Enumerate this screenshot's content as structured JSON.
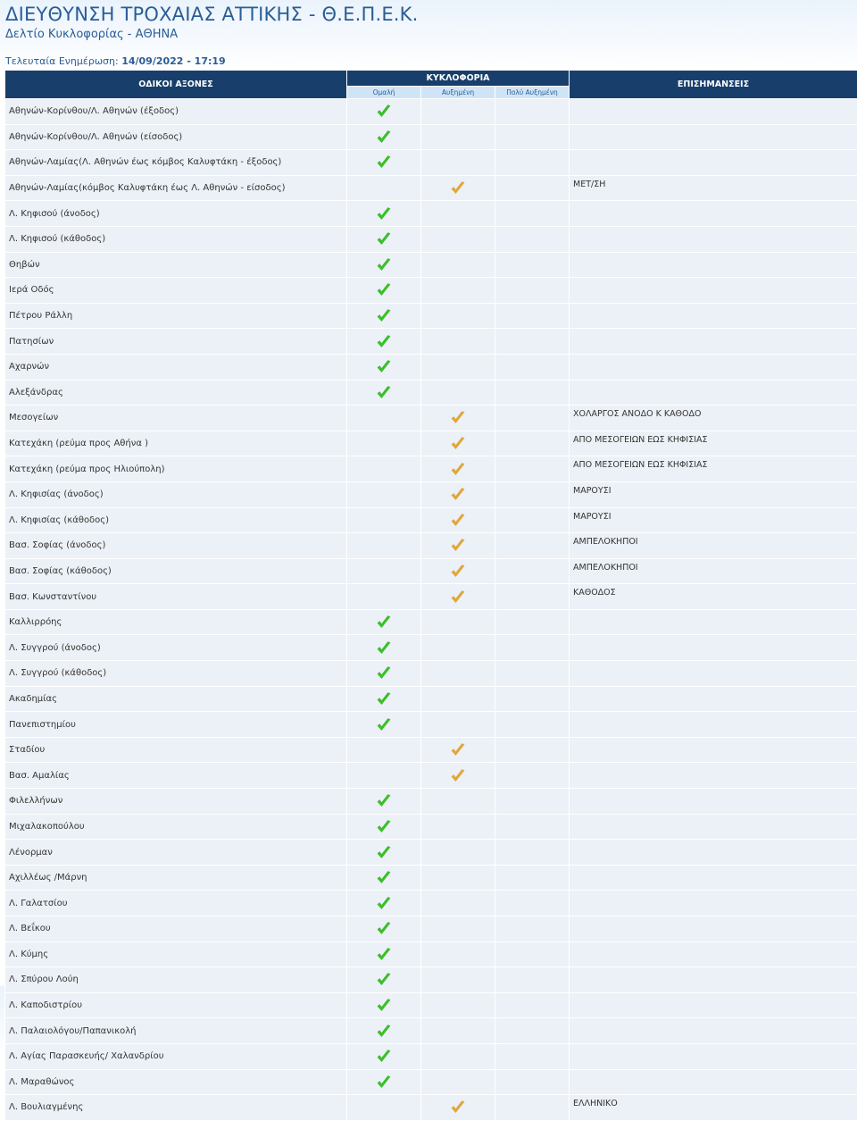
{
  "header": {
    "title": "ΔΙΕΥΘΥΝΣΗ ΤΡΟΧΑΙΑΣ ΑΤΤΙΚΗΣ - Θ.Ε.Π.Ε.Κ.",
    "subtitle": "Δελτίο Κυκλοφορίας - ΑΘΗΝΑ",
    "updated_label": "Τελευταία Ενημέρωση:",
    "updated_value": "14/09/2022 - 17:19"
  },
  "table": {
    "col_roads": "ΟΔΙΚΟΙ ΑΞΟΝΕΣ",
    "col_traffic": "ΚΥΚΛΟΦΟΡΙΑ",
    "col_notes": "ΕΠΙΣΗΜΑΝΣΕΙΣ",
    "sub_normal": "Ομαλή",
    "sub_increased": "Αυξημένη",
    "sub_very_increased": "Πολύ Αυξημένη"
  },
  "colors": {
    "normal_check": "#3cbf2a",
    "increased_check": "#e0a73a",
    "header_bg": "#183f6b",
    "subheader_bg": "#cfe5f7",
    "row_bg": "#ecf1f7",
    "title_color": "#2a5d96"
  },
  "icons": {
    "normal": "check-green-icon",
    "increased": "check-orange-icon"
  },
  "rows": [
    {
      "road": "Αθηνών-Κορίνθου/Λ. Αθηνών (έξοδος)",
      "status": "normal",
      "note": ""
    },
    {
      "road": "Αθηνών-Κορίνθου/Λ. Αθηνών (είσοδος)",
      "status": "normal",
      "note": ""
    },
    {
      "road": "Αθηνών-Λαμίας(Λ. Αθηνών έως κόμβος Καλυφτάκη - έξοδος)",
      "status": "normal",
      "note": ""
    },
    {
      "road": "Αθηνών-Λαμίας(κόμβος Καλυφτάκη έως Λ. Αθηνών - είσοδος)",
      "status": "increased",
      "note": "ΜΕΤ/ΣΗ"
    },
    {
      "road": "Λ. Κηφισού (άνοδος)",
      "status": "normal",
      "note": ""
    },
    {
      "road": "Λ. Κηφισού (κάθοδος)",
      "status": "normal",
      "note": ""
    },
    {
      "road": "Θηβών",
      "status": "normal",
      "note": ""
    },
    {
      "road": "Ιερά Οδός",
      "status": "normal",
      "note": ""
    },
    {
      "road": "Πέτρου Ράλλη",
      "status": "normal",
      "note": ""
    },
    {
      "road": "Πατησίων",
      "status": "normal",
      "note": ""
    },
    {
      "road": "Αχαρνών",
      "status": "normal",
      "note": ""
    },
    {
      "road": "Αλεξάνδρας",
      "status": "normal",
      "note": ""
    },
    {
      "road": "Μεσογείων",
      "status": "increased",
      "note": "ΧΟΛΑΡΓΟΣ ΑΝΟΔΟ Κ ΚΑΘΟΔΟ"
    },
    {
      "road": "Κατεχάκη (ρεύμα προς Αθήνα )",
      "status": "increased",
      "note": "ΑΠΟ ΜΕΣΟΓΕΙΩΝ ΕΩΣ ΚΗΦΙΣΙΑΣ"
    },
    {
      "road": "Κατεχάκη (ρεύμα προς Ηλιούπολη)",
      "status": "increased",
      "note": "ΑΠΟ ΜΕΣΟΓΕΙΩΝ ΕΩΣ ΚΗΦΙΣΙΑΣ"
    },
    {
      "road": "Λ. Κηφισίας (άνοδος)",
      "status": "increased",
      "note": "ΜΑΡΟΥΣΙ"
    },
    {
      "road": "Λ. Κηφισίας (κάθοδος)",
      "status": "increased",
      "note": "ΜΑΡΟΥΣΙ"
    },
    {
      "road": "Βασ. Σοφίας (άνοδος)",
      "status": "increased",
      "note": "ΑΜΠΕΛΟΚΗΠΟΙ"
    },
    {
      "road": "Βασ. Σοφίας (κάθοδος)",
      "status": "increased",
      "note": "ΑΜΠΕΛΟΚΗΠΟΙ"
    },
    {
      "road": "Βασ. Κωνσταντίνου",
      "status": "increased",
      "note": "ΚΑΘΟΔΟΣ"
    },
    {
      "road": "Καλλιρρόης",
      "status": "normal",
      "note": ""
    },
    {
      "road": "Λ. Συγγρού (άνοδος)",
      "status": "normal",
      "note": ""
    },
    {
      "road": "Λ. Συγγρού (κάθοδος)",
      "status": "normal",
      "note": ""
    },
    {
      "road": "Ακαδημίας",
      "status": "normal",
      "note": ""
    },
    {
      "road": "Πανεπιστημίου",
      "status": "normal",
      "note": ""
    },
    {
      "road": "Σταδίου",
      "status": "increased",
      "note": ""
    },
    {
      "road": "Βασ. Αμαλίας",
      "status": "increased",
      "note": ""
    },
    {
      "road": "Φιλελλήνων",
      "status": "normal",
      "note": ""
    },
    {
      "road": "Μιχαλακοπούλου",
      "status": "normal",
      "note": ""
    },
    {
      "road": "Λένορμαν",
      "status": "normal",
      "note": ""
    },
    {
      "road": "Αχιλλέως /Μάρνη",
      "status": "normal",
      "note": ""
    },
    {
      "road": "Λ. Γαλατσίου",
      "status": "normal",
      "note": ""
    },
    {
      "road": "Λ. Βεΐκου",
      "status": "normal",
      "note": ""
    },
    {
      "road": "Λ. Κύμης",
      "status": "normal",
      "note": ""
    },
    {
      "road": "Λ. Σπύρου Λούη",
      "status": "normal",
      "note": ""
    },
    {
      "road": "Λ. Καποδιστρίου",
      "status": "normal",
      "note": ""
    },
    {
      "road": "Λ. Παλαιολόγου/Παπανικολή",
      "status": "normal",
      "note": ""
    },
    {
      "road": "Λ. Αγίας Παρασκευής/ Χαλανδρίου",
      "status": "normal",
      "note": ""
    },
    {
      "road": "Λ. Μαραθώνος",
      "status": "normal",
      "note": ""
    },
    {
      "road": "Λ. Βουλιαγμένης",
      "status": "increased",
      "note": "ΕΛΛΗΝΙΚΟ"
    }
  ]
}
